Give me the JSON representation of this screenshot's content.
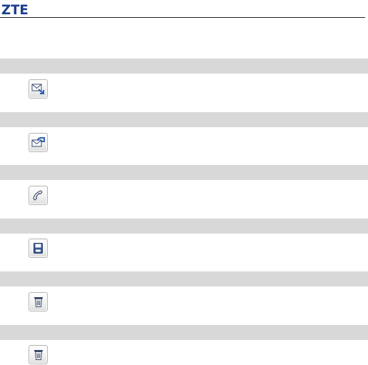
{
  "header": {
    "logo_text": "ZTE",
    "brand_color": "#1b3e8f"
  },
  "colors": {
    "section_bar": "#d8d8d8",
    "icon_stroke": "#3a4a6b",
    "icon_accent": "#2f62b6"
  },
  "rows": [
    {
      "icon": "reply-message-icon"
    },
    {
      "icon": "forward-message-icon"
    },
    {
      "icon": "call-icon"
    },
    {
      "icon": "save-icon"
    },
    {
      "icon": "delete-icon"
    },
    {
      "icon": "delete-icon"
    }
  ]
}
